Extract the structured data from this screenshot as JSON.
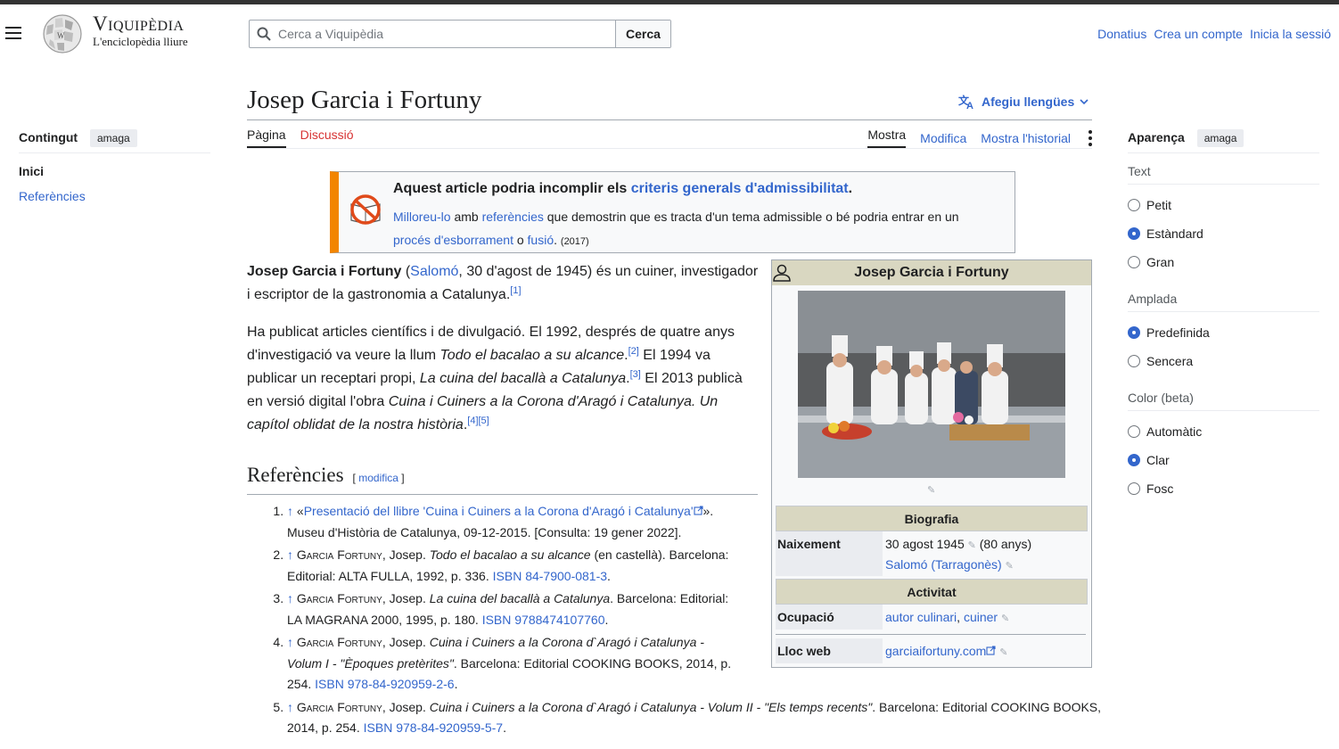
{
  "header": {
    "site_name": "Viquipèdia",
    "tagline": "L'enciclopèdia lliure",
    "search_placeholder": "Cerca a Viquipèdia",
    "search_button": "Cerca",
    "links": [
      "Donatius",
      "Crea un compte",
      "Inicia la sessió"
    ]
  },
  "toc": {
    "title": "Contingut",
    "hide": "amaga",
    "items": [
      "Inici",
      "Referències"
    ]
  },
  "page": {
    "title": "Josep Garcia i Fortuny",
    "languages": "Afegiu llengües",
    "tabs_left": [
      "Pàgina",
      "Discussió"
    ],
    "tabs_right": [
      "Mostra",
      "Modifica",
      "Mostra l'historial"
    ]
  },
  "notice": {
    "title_prefix": "Aquest article podria incomplir els ",
    "title_link": "criteris generals d'admissibilitat",
    "title_suffix": ".",
    "line_a_link1": "Milloreu-lo",
    "line_a_text1": " amb ",
    "line_a_link2": "referències",
    "line_a_text2": " que demostrin que es tracta d'un tema admissible o bé podria entrar en un ",
    "line_a_link3": "procés d'esborrament",
    "line_a_text3": " o ",
    "line_a_link4": "fusió",
    "line_a_text4": ". ",
    "year": "(2017)"
  },
  "article": {
    "p1_bold": "Josep Garcia i Fortuny",
    "p1_t1": " (",
    "p1_link": "Salomó",
    "p1_t2": ", 30 d'agost de 1945) és un cuiner, investigador i escriptor de la gastronomia a Catalunya.",
    "p1_ref": "[1]",
    "p2_t1": "Ha publicat articles científics i de divulgació. El 1992, després de quatre anys d'investigació va veure la llum ",
    "p2_i1": "Todo el bacalao a su alcance",
    "p2_t1b": ".",
    "p2_ref1": "[2]",
    "p2_t2": " El 1994 va publicar un receptari propi, ",
    "p2_i2": "La cuina del bacallà a Catalunya",
    "p2_t2b": ".",
    "p2_ref2": "[3]",
    "p2_t3": " El 2013 publicà en versió digital l'obra ",
    "p2_i3": "Cuina i Cuiners a la Corona d'Aragó i Catalunya. Un capítol oblidat de la nostra història",
    "p2_t3b": ".",
    "p2_ref3": "[4]",
    "p2_ref4": "[5]"
  },
  "references": {
    "heading": "Referències",
    "edit": "modifica",
    "arrow": "↑",
    "items": [
      {
        "pre": " «",
        "link": "Presentació del llibre 'Cuina i Cuiners a la Corona d'Aragó i Catalunya'",
        "post": "». Museu d'Història de Catalunya, 09-12-2015. [Consulta: 19 gener 2022]."
      },
      {
        "author": "Garcia Fortuny",
        "a2": ", Josep. ",
        "title": "Todo el bacalao a su alcance",
        "post": " (en castellà). Barcelona: Editorial: ALTA FULLA, 1992, p. 336. ",
        "isbn": "ISBN 84-7900-081-3",
        "end": "."
      },
      {
        "author": "Garcia Fortuny",
        "a2": ", Josep. ",
        "title": "La cuina del bacallà a Catalunya",
        "post": ". Barcelona: Editorial: LA MAGRANA 2000, 1995, p. 180. ",
        "isbn": "ISBN 9788474107760",
        "end": "."
      },
      {
        "author": "Garcia Fortuny",
        "a2": ", Josep. ",
        "title": "Cuina i Cuiners a la Corona d`Aragó i Catalunya - Volum I - \"Èpoques pretèrites\"",
        "post": ". Barcelona: Editorial COOKING BOOKS, 2014, p. 254. ",
        "isbn": "ISBN 978-84-920959-2-6",
        "end": "."
      },
      {
        "author": "Garcia Fortuny",
        "a2": ", Josep. ",
        "title": "Cuina i Cuiners a la Corona d`Aragó i Catalunya - Volum II - \"Els temps recents\"",
        "post": ". Barcelona: Editorial COOKING BOOKS, 2014, p. 254. ",
        "isbn": "ISBN 978-84-920959-5-7",
        "end": "."
      }
    ]
  },
  "infobox": {
    "title": "Josep Garcia i Fortuny",
    "section_bio": "Biografia",
    "birth_label": "Naixement",
    "birth_date": "30 agost 1945",
    "birth_age": " (80 anys)",
    "birth_place": "Salomó (Tarragonès)",
    "section_activity": "Activitat",
    "occupation_label": "Ocupació",
    "occupation_1": "autor culinari",
    "occupation_sep": ", ",
    "occupation_2": "cuiner",
    "website_label": "Lloc web",
    "website": "garciaifortuny.com"
  },
  "appearance": {
    "title": "Aparença",
    "hide": "amaga",
    "groups": [
      {
        "label": "Text",
        "options": [
          "Petit",
          "Estàndard",
          "Gran"
        ],
        "selected": 1
      },
      {
        "label": "Amplada",
        "options": [
          "Predefinida",
          "Sencera"
        ],
        "selected": 0
      },
      {
        "label": "Color (beta)",
        "options": [
          "Automàtic",
          "Clar",
          "Fosc"
        ],
        "selected": 1
      }
    ]
  },
  "colors": {
    "link": "#3366cc",
    "notice_bar": "#f28500",
    "infobox_header": "#d9d7c1",
    "redlink": "#d73333"
  }
}
